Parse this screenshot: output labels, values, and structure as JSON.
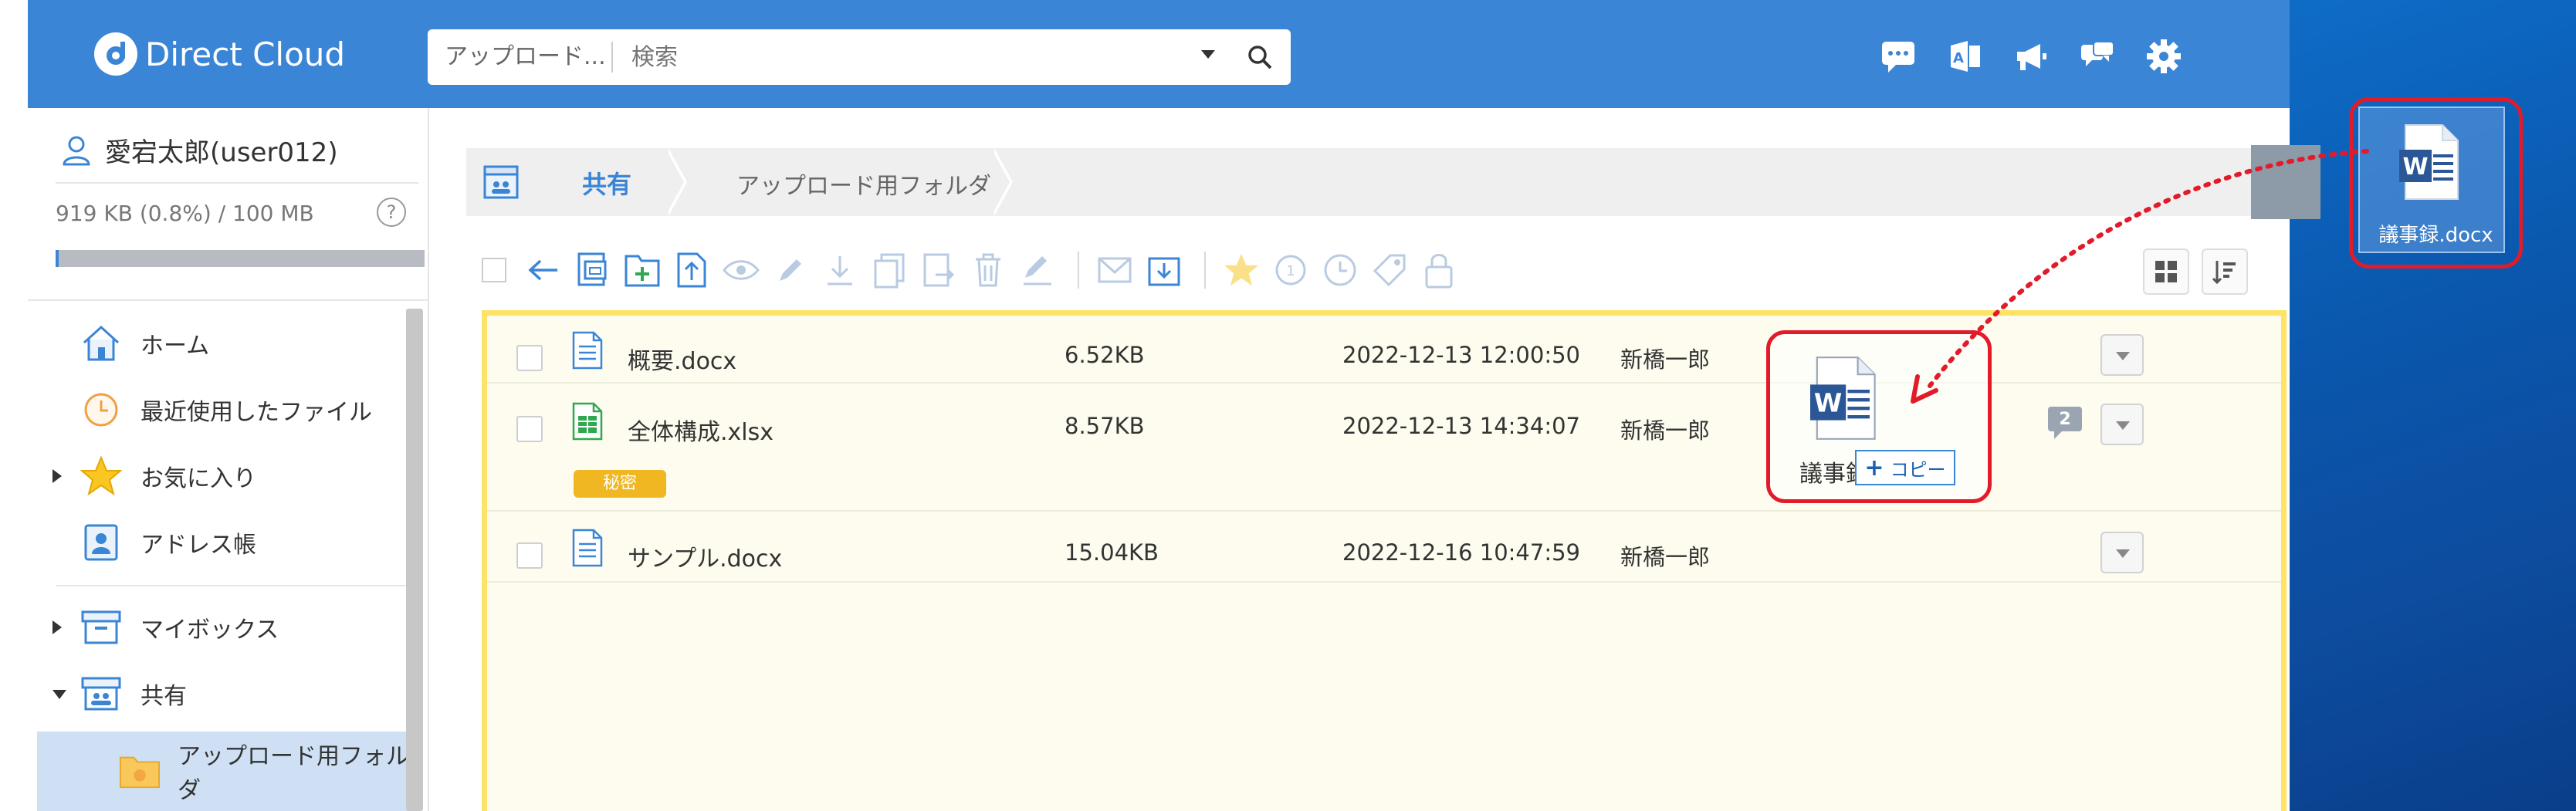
{
  "app": {
    "logo_text": "Direct Cloud",
    "search": {
      "scope": "アップロード...",
      "placeholder": "検索"
    }
  },
  "sidebar": {
    "user_name": "愛宕太郎(user012)",
    "quota_text": "919 KB (0.8%) / 100 MB",
    "quota_percent": 0.8,
    "help": "?",
    "items": [
      {
        "label": "ホーム"
      },
      {
        "label": "最近使用したファイル"
      },
      {
        "label": "お気に入り"
      },
      {
        "label": "アドレス帳"
      },
      {
        "label": "マイボックス"
      },
      {
        "label": "共有"
      },
      {
        "label": "アップロード用フォルダ"
      }
    ]
  },
  "breadcrumb": {
    "root": "共有",
    "current": "アップロード用フォルダ"
  },
  "files": [
    {
      "name": "概要.docx",
      "size": "6.52KB",
      "date": "2022-12-13 12:00:50",
      "owner": "新橋一郎",
      "type": "doc"
    },
    {
      "name": "全体構成.xlsx",
      "size": "8.57KB",
      "date": "2022-12-13 14:34:07",
      "owner": "新橋一郎",
      "type": "xls",
      "tag": "秘密",
      "comments": "2"
    },
    {
      "name": "サンプル.docx",
      "size": "15.04KB",
      "date": "2022-12-16 10:47:59",
      "owner": "新橋一郎",
      "type": "doc"
    }
  ],
  "drag": {
    "file_name": "議事録.docx",
    "ghost_label": "議事録.docx",
    "copy_label": "コピー",
    "copy_plus": "+"
  },
  "desktop": {
    "icon_label": "議事録.docx"
  },
  "colors": {
    "header": "#3b85d6",
    "highlight_border": "#e21b2a",
    "drop_zone": "#ffe366",
    "tag": "#f1b723"
  }
}
